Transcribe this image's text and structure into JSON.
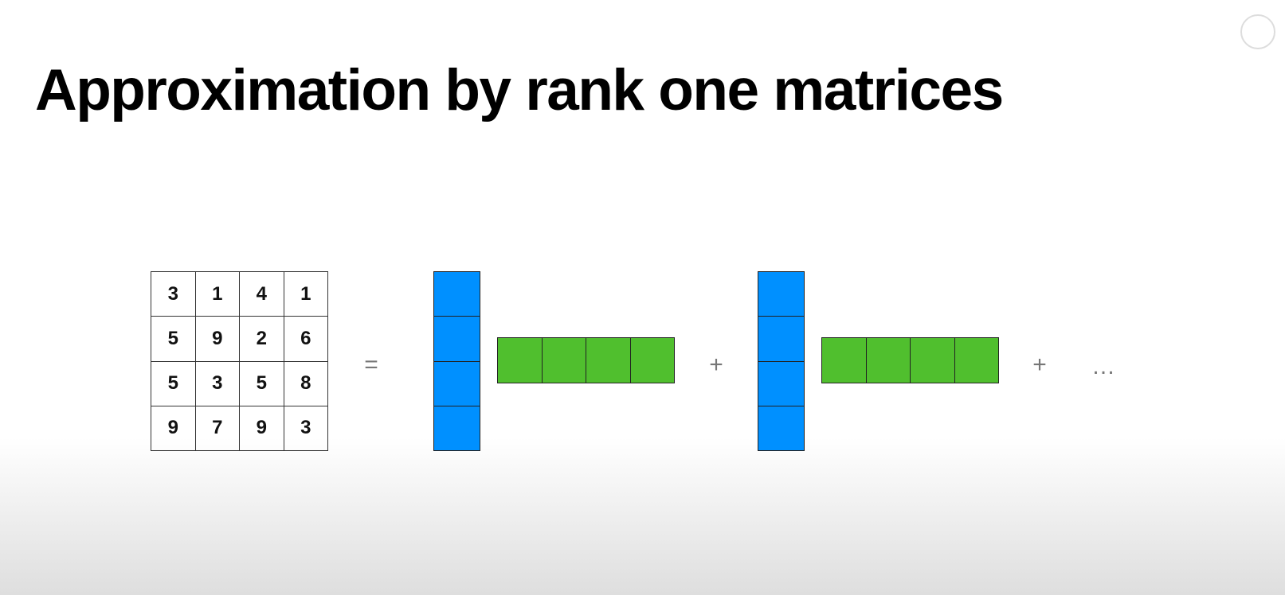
{
  "slide": {
    "title": "Approximation by rank one matrices",
    "matrix": [
      [
        "3",
        "1",
        "4",
        "1"
      ],
      [
        "5",
        "9",
        "2",
        "6"
      ],
      [
        "5",
        "3",
        "5",
        "8"
      ],
      [
        "9",
        "7",
        "9",
        "3"
      ]
    ],
    "equals": "=",
    "plus": "+",
    "ellipsis": "…",
    "colors": {
      "column_vector": "#0090ff",
      "row_vector": "#50bf2e"
    }
  }
}
